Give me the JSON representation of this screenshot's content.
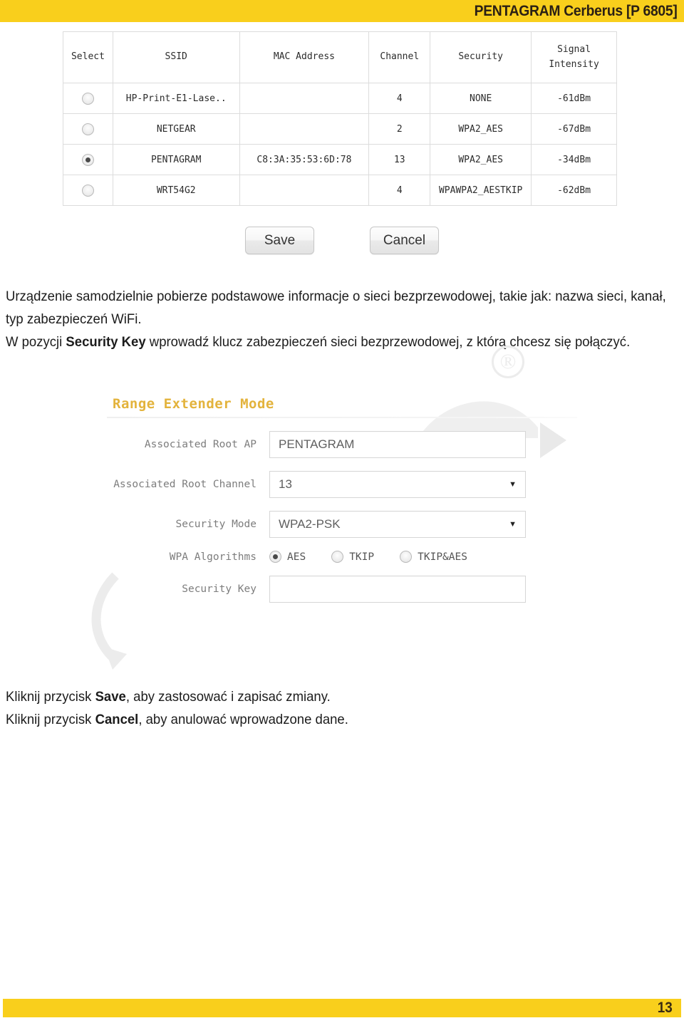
{
  "header": {
    "title": "PENTAGRAM Cerberus [P 6805]",
    "band_color": "#f9cf1c",
    "title_color": "#2b2014"
  },
  "scan_table": {
    "columns": [
      "Select",
      "SSID",
      "MAC Address",
      "Channel",
      "Security",
      "Signal Intensity"
    ],
    "signal_header_line1": "Signal",
    "signal_header_line2": "Intensity",
    "rows": [
      {
        "selected": false,
        "ssid": "HP-Print-E1-Lase..",
        "mac": "",
        "channel": "4",
        "security": "NONE",
        "signal": "-61dBm"
      },
      {
        "selected": false,
        "ssid": "NETGEAR",
        "mac": "",
        "channel": "2",
        "security": "WPA2_AES",
        "signal": "-67dBm"
      },
      {
        "selected": true,
        "ssid": "PENTAGRAM",
        "mac": "C8:3A:35:53:6D:78",
        "channel": "13",
        "security": "WPA2_AES",
        "signal": "-34dBm"
      },
      {
        "selected": false,
        "ssid": "WRT54G2",
        "mac": "",
        "channel": "4",
        "security": "WPAWPA2_AESTKIP",
        "signal": "-62dBm"
      }
    ]
  },
  "actions": {
    "save_label": "Save",
    "cancel_label": "Cancel"
  },
  "paragraph_top": {
    "line1": "Urządzenie samodzielnie pobierze podstawowe informacje o sieci bezprzewodowej, takie jak: nazwa sieci, kanał, typ zabezpieczeń WiFi.",
    "line2_before": "W pozycji ",
    "line2_bold": "Security Key",
    "line2_after": " wprowadź klucz zabezpieczeń sieci bezprzewodowej, z którą chcesz się połączyć."
  },
  "form": {
    "title": "Range Extender Mode",
    "title_color": "#e3b33c",
    "rows": {
      "root_ap": {
        "label": "Associated Root AP",
        "value": "PENTAGRAM"
      },
      "root_channel": {
        "label": "Associated Root Channel",
        "value": "13",
        "caret": "▼"
      },
      "security_mode": {
        "label": "Security Mode",
        "value": "WPA2-PSK",
        "caret": "▼"
      },
      "wpa_algorithms": {
        "label": "WPA Algorithms",
        "options": [
          {
            "label": "AES",
            "selected": true
          },
          {
            "label": "TKIP",
            "selected": false
          },
          {
            "label": "TKIP&AES",
            "selected": false
          }
        ]
      },
      "security_key": {
        "label": "Security Key",
        "value": "",
        "placeholder": ""
      }
    }
  },
  "paragraph_bottom": {
    "line1_before": "Kliknij przycisk ",
    "line1_bold": "Save",
    "line1_after": ", aby zastosować i zapisać zmiany.",
    "line2_before": "Kliknij przycisk ",
    "line2_bold": "Cancel",
    "line2_after": ", aby anulować wprowadzone dane."
  },
  "footer": {
    "page_number": "13",
    "band_color": "#f9cf1c"
  },
  "watermark": {
    "registered_mark": "®"
  }
}
